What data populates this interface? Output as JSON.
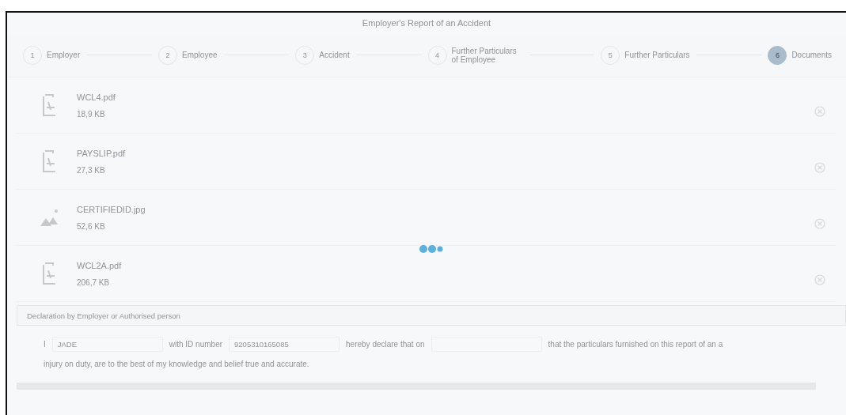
{
  "title": "Employer's Report of an Accident",
  "steps": [
    {
      "number": "1",
      "label": "Employer",
      "selected": false
    },
    {
      "number": "2",
      "label": "Employee",
      "selected": false
    },
    {
      "number": "3",
      "label": "Accident",
      "selected": false
    },
    {
      "number": "4",
      "label": "Further Particulars of Employee",
      "selected": false
    },
    {
      "number": "5",
      "label": "Further Particulars",
      "selected": false
    },
    {
      "number": "6",
      "label": "Documents",
      "selected": true
    }
  ],
  "files": [
    {
      "kind": "pdf",
      "name": "WCL4.pdf",
      "size": "18,9 KB"
    },
    {
      "kind": "pdf",
      "name": "PAYSLIP.pdf",
      "size": "27,3 KB"
    },
    {
      "kind": "image",
      "name": "CERTIFIEDID.jpg",
      "size": "52,6 KB"
    },
    {
      "kind": "pdf",
      "name": "WCL2A.pdf",
      "size": "206,7 KB"
    }
  ],
  "declaration": {
    "header": "Declaration by Employer or Authorised person",
    "line": [
      {
        "kind": "text",
        "text": "I"
      },
      {
        "kind": "field",
        "value": "JADE"
      },
      {
        "kind": "text",
        "text": "with ID number"
      },
      {
        "kind": "field",
        "value": "9205310165085"
      },
      {
        "kind": "text",
        "text": "hereby declare that on"
      },
      {
        "kind": "field"
      },
      {
        "kind": "text",
        "text": "that the particulars furnished on this report of an a"
      }
    ],
    "sentence": "injury on duty, are to the best of my knowledge and belief true and accurate."
  },
  "busy": true
}
